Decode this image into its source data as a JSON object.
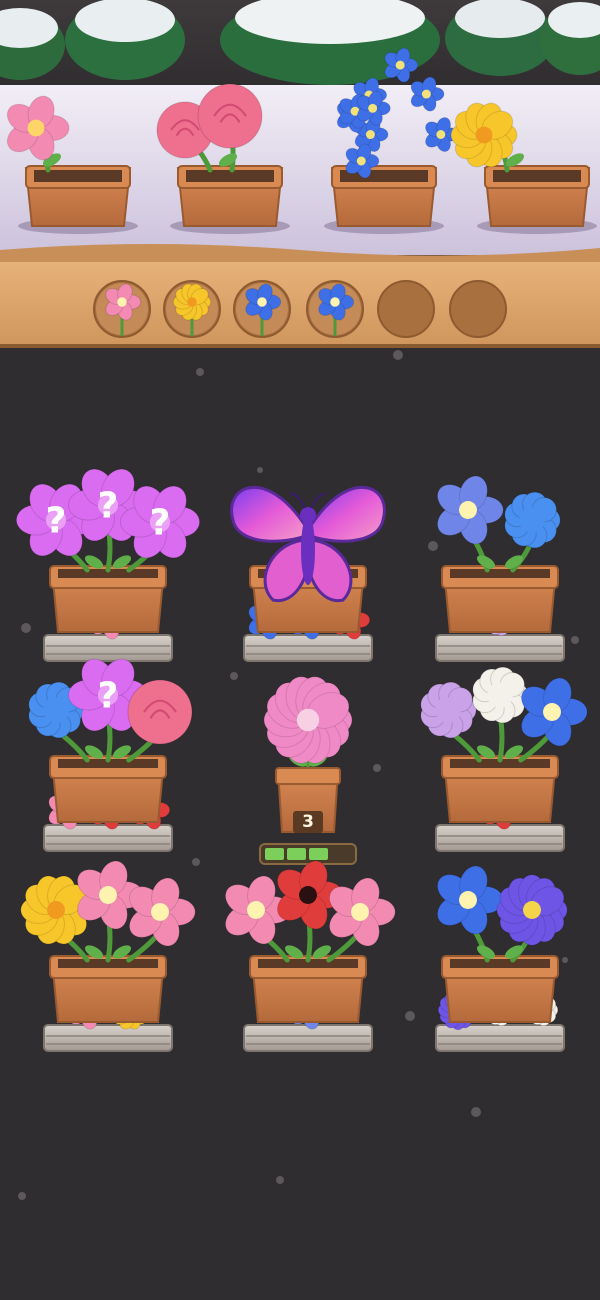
{
  "colors": {
    "background": "#2f2d2f",
    "shelf_wood": "#d9a066",
    "pot": "#c97c48",
    "pink": "#f28ab2",
    "rose": "#ef6f8f",
    "blue": "#3f6fe6",
    "yellow": "#f7c62a",
    "red": "#e03c3c",
    "purple_mystery": "#d96cf0",
    "lilac": "#c9a2e8",
    "white": "#f4f1ea",
    "progress": "#7ccf5a"
  },
  "top_shelf": {
    "pots": [
      {
        "flower": "pink-flower-icon"
      },
      {
        "flower": "rose-icon"
      },
      {
        "flower": "blue-bouquet-icon"
      },
      {
        "flower": "yellow-daisy-icon"
      }
    ]
  },
  "collection_slots": [
    {
      "filled": true,
      "flower": "pink"
    },
    {
      "filled": true,
      "flower": "yellow"
    },
    {
      "filled": true,
      "flower": "blue"
    },
    {
      "filled": true,
      "flower": "blue"
    },
    {
      "filled": false
    },
    {
      "filled": false
    }
  ],
  "board": {
    "pots": [
      {
        "id": "r1c1",
        "top": [
          "purple_mystery",
          "purple_mystery",
          "purple_mystery"
        ],
        "mystery_count": 3,
        "tray": [
          "pink"
        ]
      },
      {
        "id": "r1c2",
        "special": "butterfly-icon",
        "tray": [
          "blue",
          "blue",
          "red"
        ]
      },
      {
        "id": "r1c3",
        "top": [
          "blue_iris",
          "blue_hydrangea"
        ],
        "tray": [
          "lilac"
        ]
      },
      {
        "id": "r2c1",
        "top": [
          "blue_hydrangea",
          "purple_mystery",
          "rose"
        ],
        "mystery_count": 1,
        "tray": [
          "pink",
          "red",
          "red"
        ]
      },
      {
        "id": "r2c2",
        "small_pot": true,
        "top": [
          "pink"
        ],
        "badge": "3",
        "progress": 0.75
      },
      {
        "id": "r2c3",
        "top": [
          "lilac",
          "white",
          "blue"
        ],
        "tray": [
          "red"
        ]
      },
      {
        "id": "r3c1",
        "top": [
          "yellow",
          "pink",
          "pink"
        ],
        "tray": [
          "pink",
          "yellow"
        ]
      },
      {
        "id": "r3c2",
        "top": [
          "pink",
          "red",
          "pink"
        ],
        "tray": [
          "blue_iris"
        ]
      },
      {
        "id": "r3c3",
        "top": [
          "blue",
          "purple_aster"
        ],
        "tray": [
          "purple_aster",
          "white",
          "white"
        ]
      }
    ]
  }
}
